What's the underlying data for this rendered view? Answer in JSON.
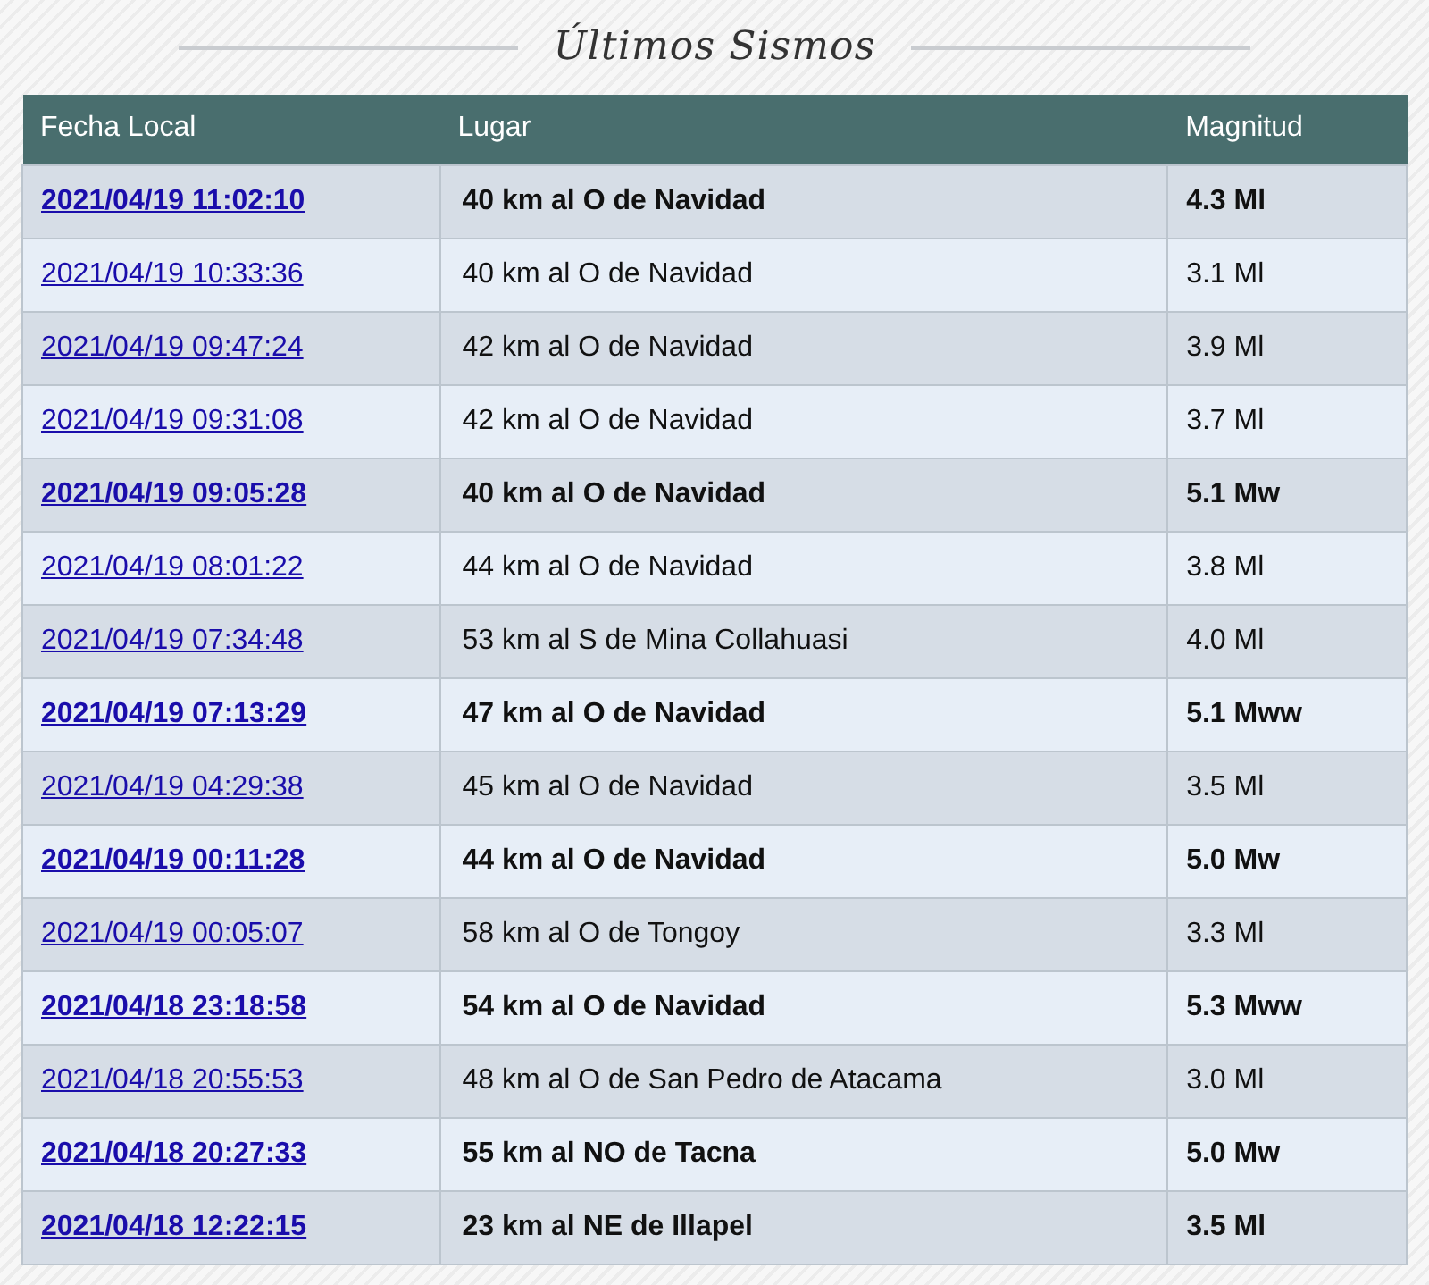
{
  "title": "Últimos Sismos",
  "table": {
    "columns": [
      "Fecha Local",
      "Lugar",
      "Magnitud"
    ],
    "rows": [
      {
        "date": "2021/04/19 11:02:10",
        "place": "40 km al O de Navidad",
        "magnitude": "4.3 Ml",
        "bold": true
      },
      {
        "date": "2021/04/19 10:33:36",
        "place": "40 km al O de Navidad",
        "magnitude": "3.1 Ml",
        "bold": false
      },
      {
        "date": "2021/04/19 09:47:24",
        "place": "42 km al O de Navidad",
        "magnitude": "3.9 Ml",
        "bold": false
      },
      {
        "date": "2021/04/19 09:31:08",
        "place": "42 km al O de Navidad",
        "magnitude": "3.7 Ml",
        "bold": false
      },
      {
        "date": "2021/04/19 09:05:28",
        "place": "40 km al O de Navidad",
        "magnitude": "5.1 Mw",
        "bold": true
      },
      {
        "date": "2021/04/19 08:01:22",
        "place": "44 km al O de Navidad",
        "magnitude": "3.8 Ml",
        "bold": false
      },
      {
        "date": "2021/04/19 07:34:48",
        "place": "53 km al S de Mina Collahuasi",
        "magnitude": "4.0 Ml",
        "bold": false
      },
      {
        "date": "2021/04/19 07:13:29",
        "place": "47 km al O de Navidad",
        "magnitude": "5.1 Mww",
        "bold": true
      },
      {
        "date": "2021/04/19 04:29:38",
        "place": "45 km al O de Navidad",
        "magnitude": "3.5 Ml",
        "bold": false
      },
      {
        "date": "2021/04/19 00:11:28",
        "place": "44 km al O de Navidad",
        "magnitude": "5.0 Mw",
        "bold": true
      },
      {
        "date": "2021/04/19 00:05:07",
        "place": "58 km al O de Tongoy",
        "magnitude": "3.3 Ml",
        "bold": false
      },
      {
        "date": "2021/04/18 23:18:58",
        "place": "54 km al O de Navidad",
        "magnitude": "5.3 Mww",
        "bold": true
      },
      {
        "date": "2021/04/18 20:55:53",
        "place": "48 km al O de San Pedro de Atacama",
        "magnitude": "3.0 Ml",
        "bold": false
      },
      {
        "date": "2021/04/18 20:27:33",
        "place": "55 km al NO de Tacna",
        "magnitude": "5.0 Mw",
        "bold": true
      },
      {
        "date": "2021/04/18 12:22:15",
        "place": "23 km al NE de Illapel",
        "magnitude": "3.5 Ml",
        "bold": true
      }
    ]
  }
}
